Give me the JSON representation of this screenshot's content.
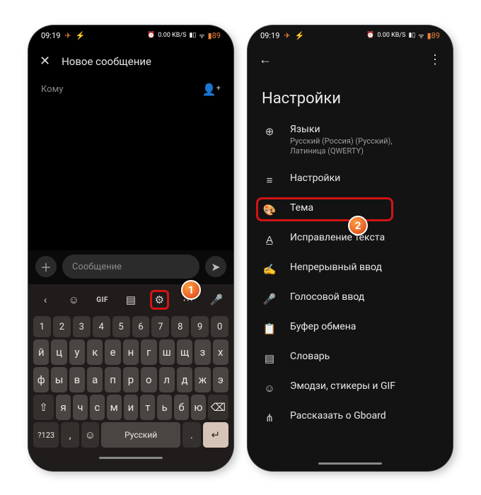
{
  "status": {
    "time": "09:19",
    "net_label": "0.00",
    "net_unit": "KB/S",
    "battery": "89"
  },
  "screen1": {
    "title": "Новое сообщение",
    "to_label": "Кому",
    "msg_placeholder": "Сообщение",
    "suggest_gif": "GIF",
    "keys_num": [
      "1",
      "2",
      "3",
      "4",
      "5",
      "6",
      "7",
      "8",
      "9",
      "0"
    ],
    "keys_r1": [
      "й",
      "ц",
      "у",
      "к",
      "е",
      "н",
      "г",
      "ш",
      "щ",
      "з",
      "х"
    ],
    "keys_r2": [
      "ф",
      "ы",
      "в",
      "а",
      "п",
      "р",
      "о",
      "л",
      "д",
      "ж",
      "э"
    ],
    "keys_r3": [
      "я",
      "ч",
      "с",
      "м",
      "и",
      "т",
      "ь",
      "б",
      "ю"
    ],
    "key_shift": "⇧",
    "key_back": "⌫",
    "key_sym": "?123",
    "key_lang": "Русский",
    "key_comma": ",",
    "key_dot": ".",
    "key_enter": "↵",
    "badge": "1"
  },
  "screen2": {
    "title": "Настройки",
    "items": [
      {
        "icon": "globe",
        "label": "Языки",
        "sub": "Русский (Россия) (Русский), Латиница (QWERTY)"
      },
      {
        "icon": "sliders",
        "label": "Настройки",
        "sub": ""
      },
      {
        "icon": "palette",
        "label": "Тема",
        "sub": ""
      },
      {
        "icon": "a-underline",
        "label": "Исправление текста",
        "sub": ""
      },
      {
        "icon": "gesture",
        "label": "Непрерывный ввод",
        "sub": ""
      },
      {
        "icon": "mic",
        "label": "Голосовой ввод",
        "sub": ""
      },
      {
        "icon": "clipboard",
        "label": "Буфер обмена",
        "sub": ""
      },
      {
        "icon": "dictionary",
        "label": "Словарь",
        "sub": ""
      },
      {
        "icon": "emoji",
        "label": "Эмодзи, стикеры и GIF",
        "sub": ""
      },
      {
        "icon": "share",
        "label": "Рассказать о Gboard",
        "sub": ""
      }
    ],
    "badge": "2",
    "highlight_index": 2
  },
  "iconGlyph": {
    "globe": "⊕",
    "sliders": "≡",
    "palette": "🎨",
    "a-underline": "A̲",
    "gesture": "✍",
    "mic": "🎤",
    "clipboard": "📋",
    "dictionary": "▤",
    "emoji": "☺",
    "share": "⋔"
  }
}
